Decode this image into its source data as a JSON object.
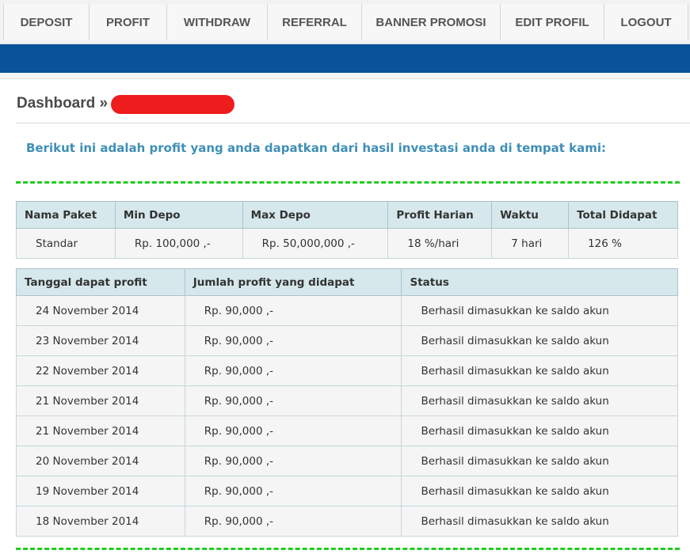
{
  "nav": {
    "items": [
      {
        "label": "DEPOSIT"
      },
      {
        "label": "PROFIT"
      },
      {
        "label": "WITHDRAW"
      },
      {
        "label": "REFERRAL"
      },
      {
        "label": "BANNER PROMOSI"
      },
      {
        "label": "EDIT PROFIL"
      },
      {
        "label": "LOGOUT"
      }
    ]
  },
  "page": {
    "title": "Dashboard »",
    "intro": "Berikut ini adalah profit yang anda dapatkan dari hasil investasi anda di tempat kami:"
  },
  "package_table": {
    "headers": [
      "Nama Paket",
      "Min Depo",
      "Max Depo",
      "Profit Harian",
      "Waktu",
      "Total Didapat"
    ],
    "row": [
      "Standar",
      "Rp. 100,000 ,-",
      "Rp. 50,000,000 ,-",
      "18 %/hari",
      "7 hari",
      "126 %"
    ]
  },
  "profit_table": {
    "headers": [
      "Tanggal dapat profit",
      "Jumlah profit yang didapat",
      "Status"
    ],
    "rows": [
      [
        "24 November 2014",
        "Rp. 90,000 ,-",
        "Berhasil dimasukkan ke saldo akun"
      ],
      [
        "23 November 2014",
        "Rp. 90,000 ,-",
        "Berhasil dimasukkan ke saldo akun"
      ],
      [
        "22 November 2014",
        "Rp. 90,000 ,-",
        "Berhasil dimasukkan ke saldo akun"
      ],
      [
        "21 November 2014",
        "Rp. 90,000 ,-",
        "Berhasil dimasukkan ke saldo akun"
      ],
      [
        "21 November 2014",
        "Rp. 90,000 ,-",
        "Berhasil dimasukkan ke saldo akun"
      ],
      [
        "20 November 2014",
        "Rp. 90,000 ,-",
        "Berhasil dimasukkan ke saldo akun"
      ],
      [
        "19 November 2014",
        "Rp. 90,000 ,-",
        "Berhasil dimasukkan ke saldo akun"
      ],
      [
        "18 November 2014",
        "Rp. 90,000 ,-",
        "Berhasil dimasukkan ke saldo akun"
      ]
    ]
  },
  "colors": {
    "nav_bar": "#0a5299",
    "intro_text": "#3f8fb7",
    "separator": "#22cc22",
    "table_header_bg": "#d6e8ec"
  }
}
